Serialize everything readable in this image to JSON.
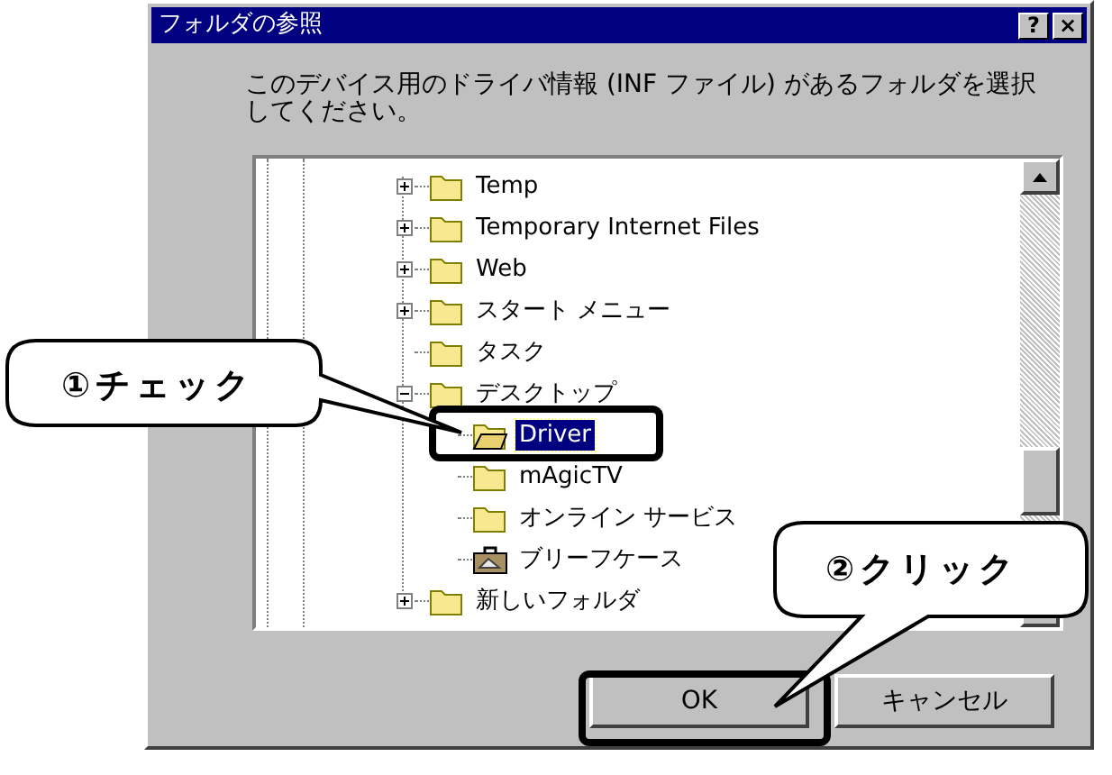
{
  "window": {
    "title": "フォルダの参照",
    "title_buttons": [
      "?",
      "×"
    ]
  },
  "prompt": "このデバイス用のドライバ情報 (INF ファイル) があるフォルダを選択してください。",
  "tree": [
    {
      "label": "Temp",
      "expanded": false
    },
    {
      "label": "Temporary Internet Files",
      "expanded": false
    },
    {
      "label": "Web",
      "expanded": false
    },
    {
      "label": "スタート メニュー",
      "expanded": false
    },
    {
      "label": "タスク"
    },
    {
      "label": "デスクトップ",
      "expanded": true,
      "children": [
        {
          "label": "Driver",
          "selected": true
        },
        {
          "label": "mAgicTV",
          "selected": false
        },
        {
          "label": "オンライン サービス",
          "selected": false
        },
        {
          "label": "ブリーフケース",
          "selected": false,
          "kind": "briefcase"
        }
      ]
    },
    {
      "label": "新しいフォルダ",
      "expanded": false
    }
  ],
  "buttons": [
    {
      "label": "OK"
    },
    {
      "label": "キャンセル"
    }
  ],
  "callouts": [
    {
      "text": "①チェック"
    },
    {
      "text": "②クリック"
    }
  ]
}
